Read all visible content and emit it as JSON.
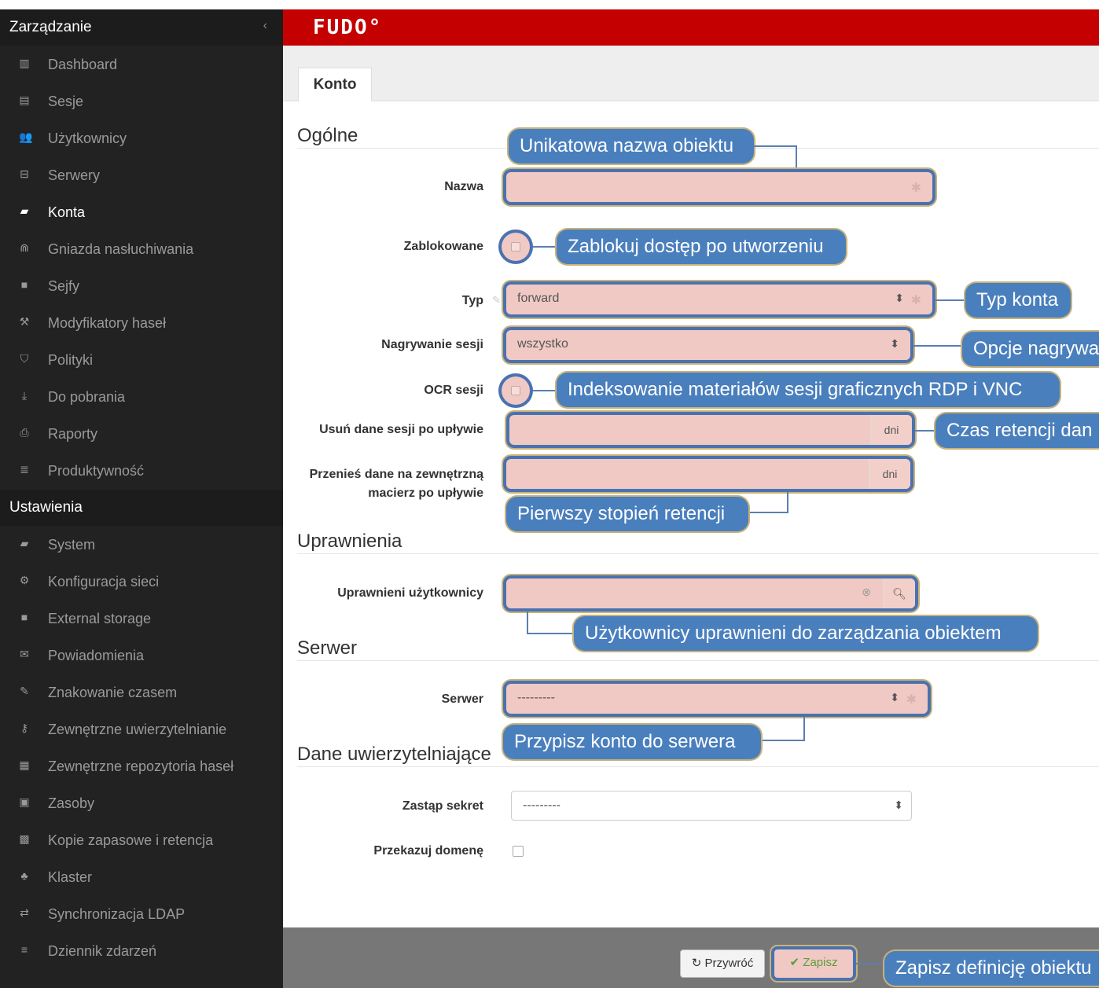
{
  "sidebar": {
    "section1_title": "Zarządzanie",
    "collapse_icon": "chevron-left-icon",
    "items1": [
      {
        "label": "Dashboard",
        "icon": "bar-chart-icon",
        "glyph": "▥"
      },
      {
        "label": "Sesje",
        "icon": "film-icon",
        "glyph": "▤"
      },
      {
        "label": "Użytkownicy",
        "icon": "users-icon",
        "glyph": "👥"
      },
      {
        "label": "Serwery",
        "icon": "server-icon",
        "glyph": "⊟"
      },
      {
        "label": "Konta",
        "icon": "account-icon",
        "glyph": "▰"
      },
      {
        "label": "Gniazda nasłuchiwania",
        "icon": "rss-icon",
        "glyph": "⋒"
      },
      {
        "label": "Sejfy",
        "icon": "safe-icon",
        "glyph": "■"
      },
      {
        "label": "Modyfikatory haseł",
        "icon": "modifier-icon",
        "glyph": "⚒"
      },
      {
        "label": "Polityki",
        "icon": "shield-icon",
        "glyph": "⛉"
      },
      {
        "label": "Do pobrania",
        "icon": "download-icon",
        "glyph": "⤓"
      },
      {
        "label": "Raporty",
        "icon": "print-icon",
        "glyph": "⎙"
      },
      {
        "label": "Produktywność",
        "icon": "list-icon",
        "glyph": "≣"
      }
    ],
    "section2_title": "Ustawienia",
    "items2": [
      {
        "label": "System",
        "icon": "folder-open-icon",
        "glyph": "▰"
      },
      {
        "label": "Konfiguracja sieci",
        "icon": "cogs-icon",
        "glyph": "⚙"
      },
      {
        "label": "External storage",
        "icon": "folder-icon",
        "glyph": "■"
      },
      {
        "label": "Powiadomienia",
        "icon": "envelope-icon",
        "glyph": "✉"
      },
      {
        "label": "Znakowanie czasem",
        "icon": "edit-icon",
        "glyph": "✎"
      },
      {
        "label": "Zewnętrzne uwierzytelnianie",
        "icon": "key-icon",
        "glyph": "⚷"
      },
      {
        "label": "Zewnętrzne repozytoria haseł",
        "icon": "grid-icon",
        "glyph": "▦"
      },
      {
        "label": "Zasoby",
        "icon": "image-icon",
        "glyph": "▣"
      },
      {
        "label": "Kopie zapasowe i retencja",
        "icon": "archive-icon",
        "glyph": "▩"
      },
      {
        "label": "Klaster",
        "icon": "sitemap-icon",
        "glyph": "♣"
      },
      {
        "label": "Synchronizacja LDAP",
        "icon": "exchange-icon",
        "glyph": "⇄"
      },
      {
        "label": "Dziennik zdarzeń",
        "icon": "menu-icon",
        "glyph": "≡"
      }
    ]
  },
  "header": {
    "logo": "FUDO°"
  },
  "tab": {
    "label": "Konto"
  },
  "sections": {
    "general": "Ogólne",
    "permissions": "Uprawnienia",
    "server": "Serwer",
    "credentials": "Dane uwierzytelniające"
  },
  "form": {
    "name_label": "Nazwa",
    "blocked_label": "Zablokowane",
    "type_label": "Typ",
    "type_value": "forward",
    "recording_label": "Nagrywanie sesji",
    "recording_value": "wszystko",
    "ocr_label": "OCR sesji",
    "delete_label": "Usuń dane sesji po upływie",
    "delete_unit": "dni",
    "move_label_line1": "Przenieś dane na zewnętrzną",
    "move_label_line2": "macierz po upływie",
    "move_unit": "dni",
    "users_label": "Uprawnieni użytkownicy",
    "server_label": "Serwer",
    "server_value": "---------",
    "replace_secret_label": "Zastąp sekret",
    "replace_secret_value": "---------",
    "pass_domain_label": "Przekazuj domenę"
  },
  "callouts": {
    "name": "Unikatowa nazwa obiektu",
    "blocked": "Zablokuj dostęp po utworzeniu",
    "type": "Typ konta",
    "recording": "Opcje nagrywa",
    "ocr": "Indeksowanie materiałów sesji graficznych RDP i VNC",
    "delete": "Czas retencji dan",
    "move": "Pierwszy stopień retencji",
    "users": "Użytkownicy uprawnieni do zarządzania obiektem",
    "server": "Przypisz konto do serwera",
    "save": "Zapisz definicję obiektu"
  },
  "footer": {
    "reset_label": "Przywróć",
    "save_label": "Zapisz"
  },
  "colors": {
    "brand": "#c40000",
    "sidebar": "#222222",
    "callout": "#4a7fbd",
    "field_highlight": "#f0c9c4"
  }
}
